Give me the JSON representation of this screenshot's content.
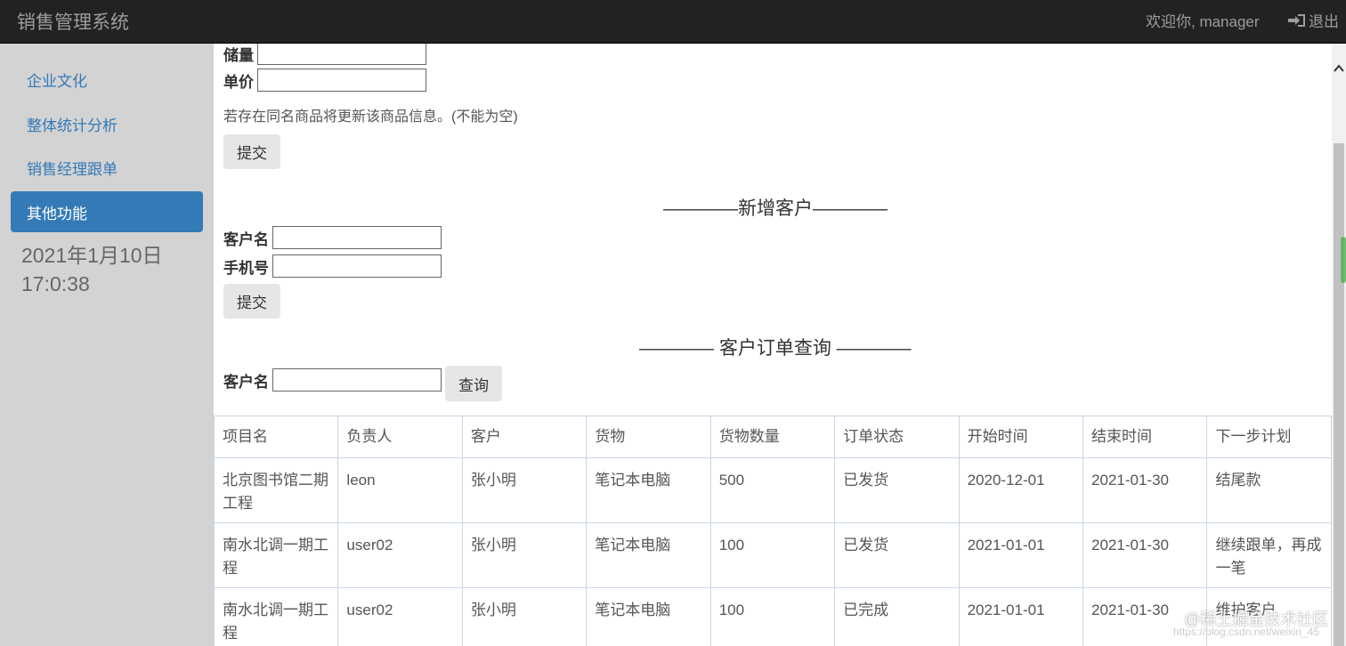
{
  "header": {
    "brand": "销售管理系统",
    "welcome": "欢迎你, manager",
    "logout_label": "退出"
  },
  "sidebar": {
    "items": [
      {
        "label": "企业文化"
      },
      {
        "label": "整体统计分析"
      },
      {
        "label": "销售经理跟单"
      },
      {
        "label": "其他功能",
        "active": true
      }
    ],
    "date": "2021年1月10日",
    "time": "17:0:38"
  },
  "product_form": {
    "stock_label": "储量",
    "price_label": "单价",
    "note": "若存在同名商品将更新该商品信息。(不能为空)",
    "submit_label": "提交"
  },
  "customer_form": {
    "title": "————新增客户————",
    "name_label": "客户名",
    "phone_label": "手机号",
    "submit_label": "提交"
  },
  "order_query": {
    "title": "———— 客户订单查询 ————",
    "name_label": "客户名",
    "query_label": "查询"
  },
  "orders_table": {
    "headers": [
      "项目名",
      "负责人",
      "客户",
      "货物",
      "货物数量",
      "订单状态",
      "开始时间",
      "结束时间",
      "下一步计划"
    ],
    "rows": [
      [
        "北京图书馆二期工程",
        "leon",
        "张小明",
        "笔记本电脑",
        "500",
        "已发货",
        "2020-12-01",
        "2021-01-30",
        "结尾款"
      ],
      [
        "南水北调一期工程",
        "user02",
        "张小明",
        "笔记本电脑",
        "100",
        "已发货",
        "2021-01-01",
        "2021-01-30",
        "继续跟单，再成一笔"
      ],
      [
        "南水北调一期工程",
        "user02",
        "张小明",
        "笔记本电脑",
        "100",
        "已完成",
        "2021-01-01",
        "2021-01-30",
        "维护客户"
      ]
    ]
  },
  "watermark": {
    "text": "@稀土掘金技术社区",
    "url": "https://blog.csdn.net/weixin_45"
  },
  "colors": {
    "navbar": "#222222",
    "accent": "#337ab7",
    "sidebar_bg": "#d3d3d3"
  }
}
